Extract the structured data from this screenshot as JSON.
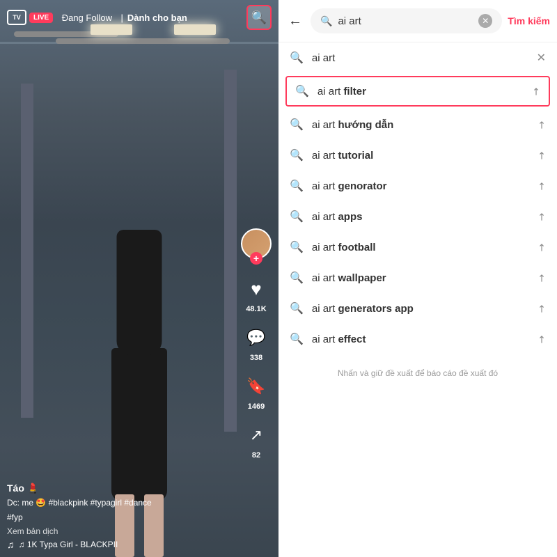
{
  "left": {
    "nav": {
      "follow_label": "Đang Follow",
      "live_label": "LIVE",
      "for_you_label": "Dành cho bạn"
    },
    "video": {
      "user_name": "Táo 💄",
      "dc_line": "Dc: me 🤩 #blackpink #typagirl #dance",
      "fyp_line": "#fyp",
      "translate": "Xem bản dịch",
      "music": "♫ 1K   Typa Girl - BLACKPII"
    },
    "actions": {
      "like_count": "48.1K",
      "comment_count": "338",
      "save_count": "1469",
      "share_count": "82"
    }
  },
  "right": {
    "search": {
      "query": "ai art",
      "search_button": "Tìm kiếm"
    },
    "results": [
      {
        "id": "1",
        "prefix": "ai art",
        "suffix": "",
        "bold_suffix": false,
        "has_close": true,
        "highlighted": false
      },
      {
        "id": "2",
        "prefix": "ai art ",
        "suffix": "filter",
        "bold_suffix": true,
        "has_close": false,
        "highlighted": true
      },
      {
        "id": "3",
        "prefix": "ai art ",
        "suffix": "hướng dẫn",
        "bold_suffix": true,
        "has_close": false,
        "highlighted": false
      },
      {
        "id": "4",
        "prefix": "ai art ",
        "suffix": "tutorial",
        "bold_suffix": true,
        "has_close": false,
        "highlighted": false
      },
      {
        "id": "5",
        "prefix": "ai art ",
        "suffix": "genorator",
        "bold_suffix": true,
        "has_close": false,
        "highlighted": false
      },
      {
        "id": "6",
        "prefix": "ai art ",
        "suffix": "apps",
        "bold_suffix": true,
        "has_close": false,
        "highlighted": false
      },
      {
        "id": "7",
        "prefix": "ai art ",
        "suffix": "football",
        "bold_suffix": true,
        "has_close": false,
        "highlighted": false
      },
      {
        "id": "8",
        "prefix": "ai art ",
        "suffix": "wallpaper",
        "bold_suffix": true,
        "has_close": false,
        "highlighted": false
      },
      {
        "id": "9",
        "prefix": "ai art ",
        "suffix": "generators app",
        "bold_suffix": true,
        "has_close": false,
        "highlighted": false
      },
      {
        "id": "10",
        "prefix": "ai art ",
        "suffix": "effect",
        "bold_suffix": true,
        "has_close": false,
        "highlighted": false
      }
    ],
    "hint": "Nhấn và giữ đề xuất để báo cáo đề xuất đó"
  }
}
